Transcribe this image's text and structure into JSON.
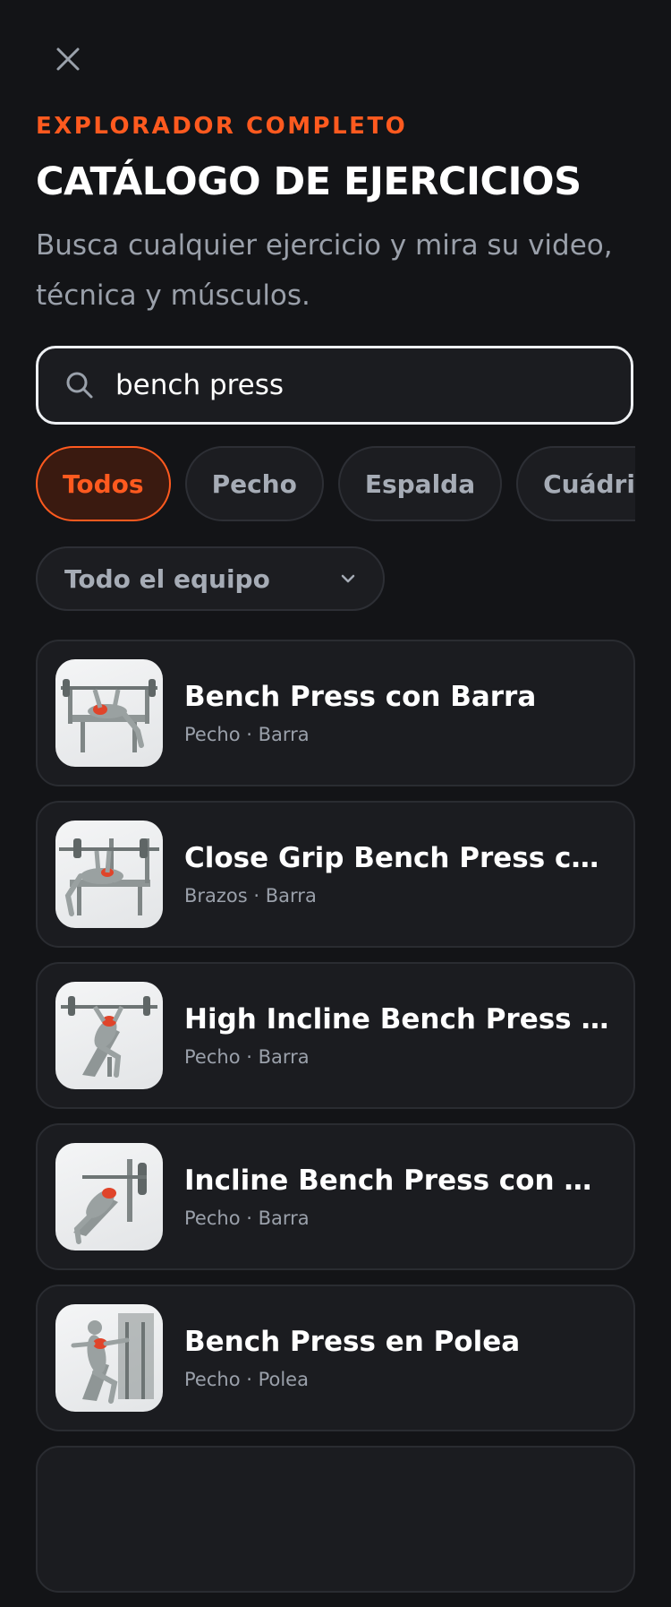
{
  "header": {
    "eyebrow": "EXPLORADOR COMPLETO",
    "title": "CATÁLOGO DE EJERCICIOS",
    "subtitle": "Busca cualquier ejercicio y mira su video, técnica y músculos."
  },
  "search": {
    "value": "bench press",
    "icon": "search-icon"
  },
  "filters": {
    "chips": [
      {
        "label": "Todos",
        "active": true
      },
      {
        "label": "Pecho",
        "active": false
      },
      {
        "label": "Espalda",
        "active": false
      },
      {
        "label": "Cuádriceps",
        "active": false
      }
    ],
    "equipment": {
      "selected": "Todo el equipo",
      "icon": "chevron-down-icon"
    }
  },
  "results": [
    {
      "title": "Bench Press con Barra",
      "muscle": "Pecho",
      "equipment": "Barra"
    },
    {
      "title": "Close Grip Bench Press con Barra",
      "muscle": "Brazos",
      "equipment": "Barra"
    },
    {
      "title": "High Incline Bench Press con Barra",
      "muscle": "Pecho",
      "equipment": "Barra"
    },
    {
      "title": "Incline Bench Press con Barra",
      "muscle": "Pecho",
      "equipment": "Barra"
    },
    {
      "title": "Bench Press en Polea",
      "muscle": "Pecho",
      "equipment": "Polea"
    }
  ],
  "meta_separator": " · ",
  "colors": {
    "accent": "#ff5a1f",
    "background": "#131417",
    "card": "#1b1c20"
  }
}
